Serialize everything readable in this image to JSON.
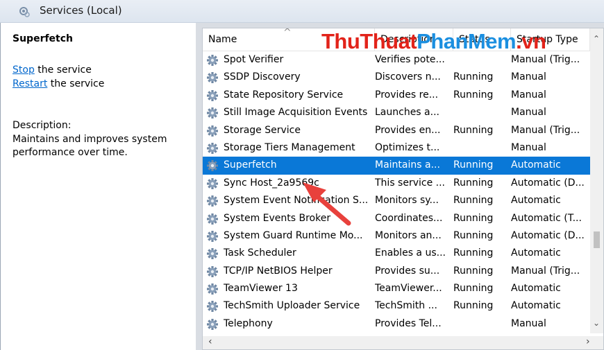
{
  "window": {
    "title": "Services (Local)"
  },
  "detail": {
    "service_name": "Superfetch",
    "actions": [
      {
        "link": "Stop",
        "rest": " the service"
      },
      {
        "link": "Restart",
        "rest": " the service"
      }
    ],
    "description_label": "Description:",
    "description_text": "Maintains and improves system performance over time."
  },
  "columns": [
    "Name",
    "Description",
    "Status",
    "Startup Type"
  ],
  "rows": [
    {
      "name": "Spot Verifier",
      "desc": "Verifies pote...",
      "status": "",
      "startup": "Manual (Trig..."
    },
    {
      "name": "SSDP Discovery",
      "desc": "Discovers n...",
      "status": "Running",
      "startup": "Manual"
    },
    {
      "name": "State Repository Service",
      "desc": "Provides re...",
      "status": "Running",
      "startup": "Manual"
    },
    {
      "name": "Still Image Acquisition Events",
      "desc": "Launches a...",
      "status": "",
      "startup": "Manual"
    },
    {
      "name": "Storage Service",
      "desc": "Provides en...",
      "status": "Running",
      "startup": "Manual (Trig..."
    },
    {
      "name": "Storage Tiers Management",
      "desc": "Optimizes t...",
      "status": "",
      "startup": "Manual"
    },
    {
      "name": "Superfetch",
      "desc": "Maintains a...",
      "status": "Running",
      "startup": "Automatic",
      "selected": true
    },
    {
      "name": "Sync Host_2a9569c",
      "desc": "This service ...",
      "status": "Running",
      "startup": "Automatic (D..."
    },
    {
      "name": "System Event Notification S...",
      "desc": "Monitors sy...",
      "status": "Running",
      "startup": "Automatic"
    },
    {
      "name": "System Events Broker",
      "desc": "Coordinates...",
      "status": "Running",
      "startup": "Automatic (T..."
    },
    {
      "name": "System Guard Runtime Mo...",
      "desc": "Monitors an...",
      "status": "Running",
      "startup": "Automatic (D..."
    },
    {
      "name": "Task Scheduler",
      "desc": "Enables a us...",
      "status": "Running",
      "startup": "Automatic"
    },
    {
      "name": "TCP/IP NetBIOS Helper",
      "desc": "Provides su...",
      "status": "Running",
      "startup": "Manual (Trig..."
    },
    {
      "name": "TeamViewer 13",
      "desc": "TeamViewer...",
      "status": "Running",
      "startup": "Automatic"
    },
    {
      "name": "TechSmith Uploader Service",
      "desc": "TechSmith ...",
      "status": "Running",
      "startup": "Automatic"
    },
    {
      "name": "Telephony",
      "desc": "Provides Tel...",
      "status": "",
      "startup": "Manual"
    }
  ],
  "watermark": {
    "part1": "ThuThuat",
    "part2": "PhanMem",
    "part3": ".vn"
  },
  "colors": {
    "selection": "#0a78d7",
    "link": "#0066cc",
    "arrow": "#e8413c"
  },
  "icons": {
    "service": "gear-icon",
    "title": "services-icon"
  }
}
